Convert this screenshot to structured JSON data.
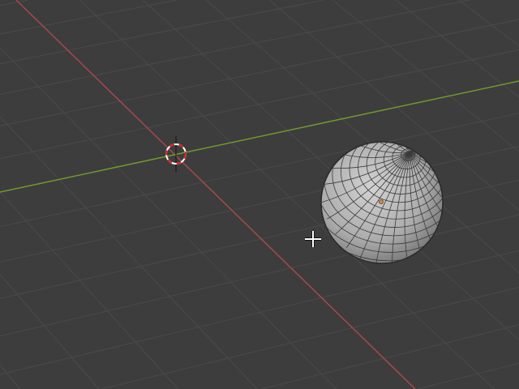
{
  "viewport": {
    "background_color": "#3d3d3d",
    "grid_color": "#4a4a4a",
    "x_axis_color": "#a8474f",
    "y_axis_color": "#6f9a2d"
  },
  "sphere": {
    "base_color": "#b5b5b5",
    "wire_color": "#333333",
    "origin_color": "#e8872a"
  },
  "cursor_3d": {
    "ring_red": "#e02020",
    "ring_white": "#ffffff"
  }
}
